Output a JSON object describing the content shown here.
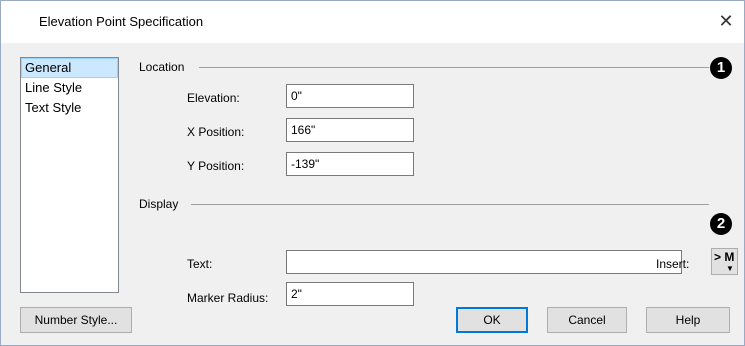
{
  "window": {
    "title": "Elevation Point Specification",
    "close_glyph": "✕"
  },
  "sidebar": {
    "items": [
      {
        "label": "General",
        "selected": true
      },
      {
        "label": "Line Style",
        "selected": false
      },
      {
        "label": "Text Style",
        "selected": false
      }
    ]
  },
  "location": {
    "label": "Location",
    "callout": "1",
    "elevation": {
      "label": "Elevation:",
      "value": "0\""
    },
    "x_position": {
      "label": "X Position:",
      "value": "166\""
    },
    "y_position": {
      "label": "Y Position:",
      "value": "-139\""
    }
  },
  "display": {
    "label": "Display",
    "callout": "2",
    "text": {
      "label": "Text:",
      "value": ""
    },
    "insert_label": "Insert:",
    "insert_button": {
      "label": "> M",
      "arrow": "▼"
    },
    "marker_radius": {
      "label": "Marker Radius:",
      "value": "2\""
    }
  },
  "buttons": {
    "number_style": "Number Style...",
    "ok": "OK",
    "cancel": "Cancel",
    "help": "Help"
  },
  "colors": {
    "selection_bg": "#cce8ff",
    "default_button_border": "#0078d7"
  }
}
